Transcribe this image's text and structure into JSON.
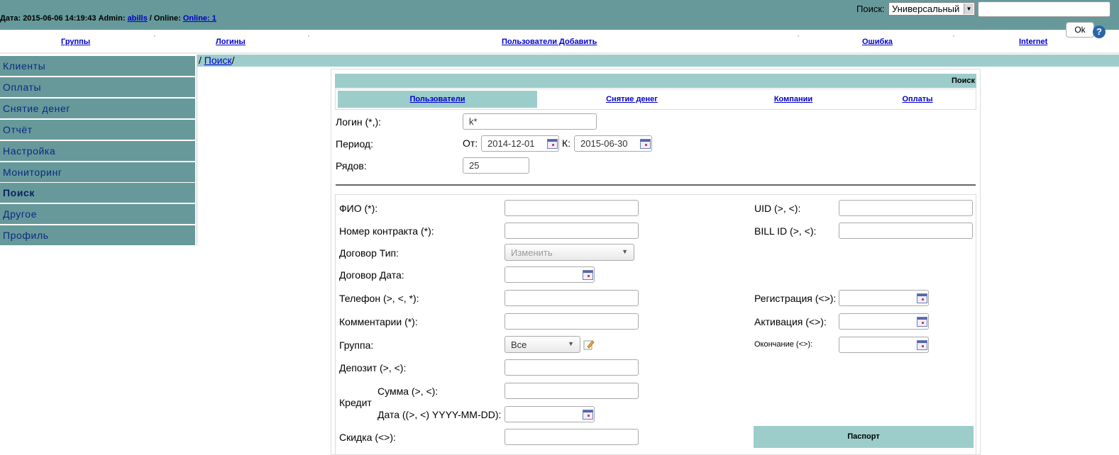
{
  "header": {
    "date_label": "Дата:",
    "date_value": "2015-06-06 14:19:43",
    "admin_label": "Admin:",
    "admin_name": "abills",
    "online_sep": "/ Online:",
    "online_link": "Online: 1",
    "search_label": "Поиск:",
    "search_type": "Универсальный",
    "search_value": "",
    "ok_label": "Ok",
    "help_glyph": "?"
  },
  "nav": {
    "items": [
      "Группы",
      "Логины",
      "Пользователи Добавить",
      "Ошибка",
      "Internet"
    ]
  },
  "sidebar": {
    "items": [
      {
        "label": "Клиенты"
      },
      {
        "label": "Оплаты"
      },
      {
        "label": "Снятие денег"
      },
      {
        "label": "Отчёт"
      },
      {
        "label": "Настройка"
      },
      {
        "label": "Мониторинг"
      },
      {
        "label": "Поиск"
      },
      {
        "label": "Другое"
      },
      {
        "label": "Профиль"
      }
    ],
    "active": "Поиск"
  },
  "breadcrumb": {
    "prefix": "/",
    "link": "Поиск",
    "suffix": "/"
  },
  "panel": {
    "title": "Поиск",
    "tabs": [
      "Пользователи",
      "Снятие денег",
      "Компании",
      "Оплаты"
    ],
    "active_tab": "Пользователи"
  },
  "form": {
    "login_label": "Логин (*,):",
    "login_value": "k*",
    "period_label": "Период:",
    "from_label": "От:",
    "from_value": "2014-12-01",
    "to_label": "К:",
    "to_value": "2015-06-30",
    "rows_label": "Рядов:",
    "rows_value": "25",
    "fio_label": "ФИО (*):",
    "contract_label": "Номер контракта (*):",
    "contract_type_label": "Договор Тип:",
    "contract_type_value": "Изменить",
    "contract_date_label": "Договор Дата:",
    "phone_label": "Телефон (>, <, *):",
    "comments_label": "Комментарии (*):",
    "group_label": "Группа:",
    "group_value": "Все",
    "deposit_label": "Депозит (>, <):",
    "credit_label": "Кредит",
    "credit_sum_label": "Сумма (>, <):",
    "credit_date_label": "Дата ((>, <) YYYY-MM-DD):",
    "discount_label": "Скидка (<>):",
    "uid_label": "UID (>, <):",
    "bill_label": "BILL ID (>, <):",
    "registration_label": "Регистрация (<>):",
    "activation_label": "Активация (<>):",
    "expire_label": "Окончание (<>):",
    "passport_label": "Паспорт"
  }
}
